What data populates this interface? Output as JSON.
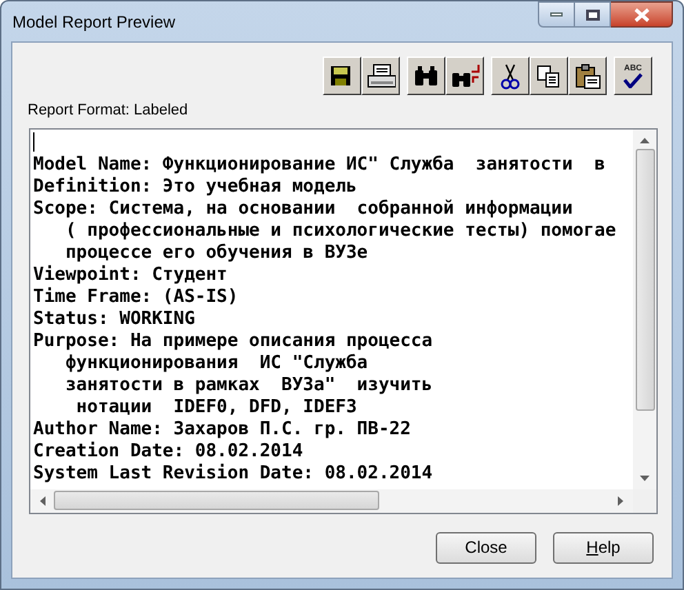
{
  "window": {
    "title": "Model Report Preview"
  },
  "toolbar": [
    {
      "kind": "save"
    },
    {
      "kind": "print"
    },
    {
      "kind": "find"
    },
    {
      "kind": "replace"
    },
    {
      "kind": "cut"
    },
    {
      "kind": "copy"
    },
    {
      "kind": "paste"
    },
    {
      "kind": "spell",
      "label": "ABC"
    }
  ],
  "report_format": "Report Format: Labeled",
  "report_lines": [
    "Model Name: Функционирование ИС\" Служба  занятости  в",
    "Definition: Это учебная модель",
    "Scope: Система, на основании  собранной информации",
    "   ( профессиональные и психологические тесты) помогае",
    "   процессе его обучения в ВУЗе",
    "Viewpoint: Студент",
    "Time Frame: (AS-IS)",
    "Status: WORKING",
    "Purpose: На примере описания процесса",
    "   функционирования  ИС \"Служба",
    "   занятости в рамках  ВУЗа\"  изучить",
    "    нотации  IDEF0, DFD, IDEF3",
    "Author Name: Захаров П.С. гр. ПВ-22",
    "Creation Date: 08.02.2014",
    "System Last Revision Date: 08.02.2014"
  ],
  "buttons": [
    {
      "label": "Close",
      "kind": "plain"
    },
    {
      "label": "Help",
      "kind": "mnemonic"
    }
  ]
}
